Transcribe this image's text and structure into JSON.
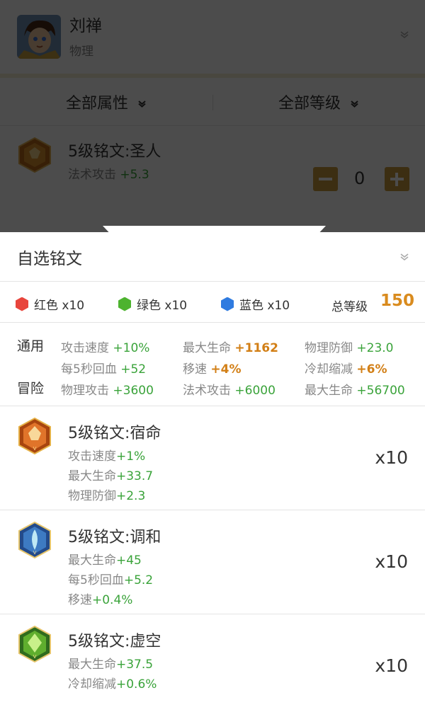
{
  "hero": {
    "name": "刘禅",
    "type": "物理"
  },
  "filters": {
    "attr": "全部属性",
    "level": "全部等级"
  },
  "selected": {
    "title": "5级铭文:圣人",
    "attr_label": "法术攻击",
    "attr_value": "+5.3",
    "count": "0"
  },
  "panel": {
    "title": "自选铭文",
    "colors": [
      {
        "label": "红色 x10",
        "color": "#e8453c"
      },
      {
        "label": "绿色 x10",
        "color": "#4db32f"
      },
      {
        "label": "蓝色 x10",
        "color": "#2f7be0"
      }
    ],
    "total_label": "总等级",
    "total_value": "150",
    "general_label": "通用",
    "adventure_label": "冒险",
    "general": [
      {
        "label": "攻击速度",
        "value": "+10%",
        "tone": "green"
      },
      {
        "label": "最大生命",
        "value": "+1162",
        "tone": "orange"
      },
      {
        "label": "物理防御",
        "value": "+23.0",
        "tone": "green"
      },
      {
        "label": "每5秒回血",
        "value": "+52",
        "tone": "green"
      },
      {
        "label": "移速",
        "value": "+4%",
        "tone": "orange"
      },
      {
        "label": "冷却缩减",
        "value": "+6%",
        "tone": "orange"
      }
    ],
    "adventure": [
      {
        "label": "物理攻击",
        "value": "+3600"
      },
      {
        "label": "法术攻击",
        "value": "+6000"
      },
      {
        "label": "最大生命",
        "value": "+56700"
      }
    ]
  },
  "runes": [
    {
      "title": "5级铭文:宿命",
      "icon": "red-rune-icon",
      "count": "x10",
      "attrs": [
        {
          "label": "攻击速度",
          "value": "+1%"
        },
        {
          "label": "最大生命",
          "value": "+33.7"
        },
        {
          "label": "物理防御",
          "value": "+2.3"
        }
      ]
    },
    {
      "title": "5级铭文:调和",
      "icon": "blue-rune-icon",
      "count": "x10",
      "attrs": [
        {
          "label": "最大生命",
          "value": "+45"
        },
        {
          "label": "每5秒回血",
          "value": "+5.2"
        },
        {
          "label": "移速",
          "value": "+0.4%"
        }
      ]
    },
    {
      "title": "5级铭文:虚空",
      "icon": "green-rune-icon",
      "count": "x10",
      "attrs": [
        {
          "label": "最大生命",
          "value": "+37.5"
        },
        {
          "label": "冷却缩减",
          "value": "+0.6%"
        }
      ]
    }
  ]
}
